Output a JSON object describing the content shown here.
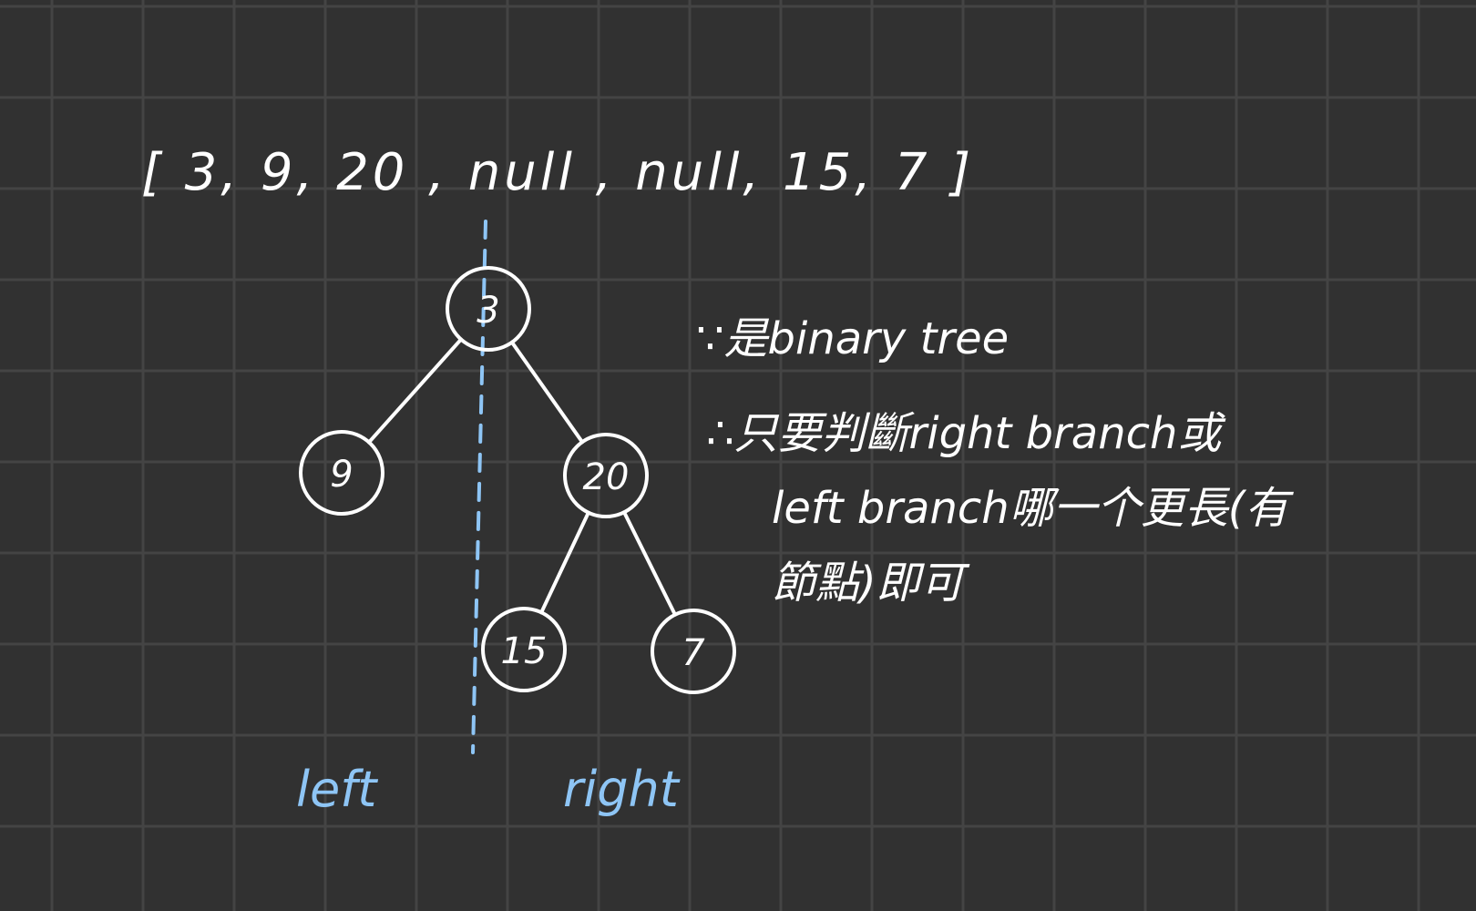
{
  "array_text": "[ 3, 9, 20 , null , null, 15, 7 ]",
  "tree": {
    "nodes": [
      {
        "id": "n3",
        "label": "3"
      },
      {
        "id": "n9",
        "label": "9"
      },
      {
        "id": "n20",
        "label": "20"
      },
      {
        "id": "n15",
        "label": "15"
      },
      {
        "id": "n7",
        "label": "7"
      }
    ],
    "edges": [
      [
        "n3",
        "n9"
      ],
      [
        "n3",
        "n20"
      ],
      [
        "n20",
        "n15"
      ],
      [
        "n20",
        "n7"
      ]
    ]
  },
  "side_labels": {
    "left": "left",
    "right": "right"
  },
  "notes": [
    "∵是binary tree",
    "∴只要判斷right branch或",
    "left branch哪一个更長(有",
    "節點)即可"
  ],
  "colors": {
    "background": "#313131",
    "grid": "#444444",
    "ink": "#ffffff",
    "accent": "#8ec5f5"
  }
}
